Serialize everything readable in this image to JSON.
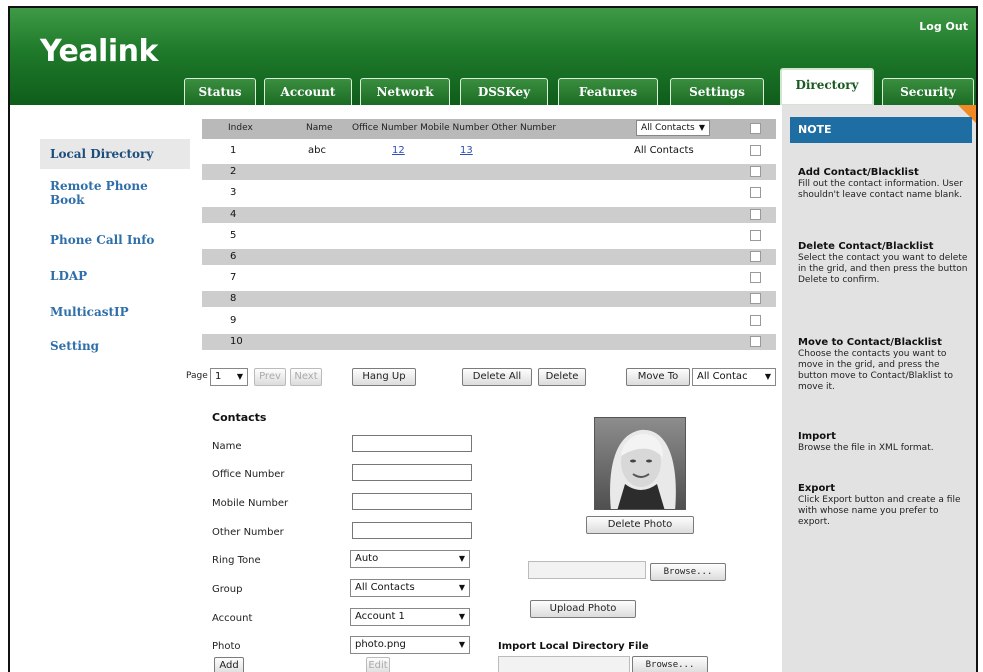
{
  "header": {
    "logo": "Yealink",
    "logout": "Log Out",
    "tabs": [
      "Status",
      "Account",
      "Network",
      "DSSKey",
      "Features",
      "Settings",
      "Directory",
      "Security"
    ],
    "active_tab": "Directory"
  },
  "sidebar": {
    "items": [
      "Local Directory",
      "Remote Phone\nBook",
      "Phone Call Info",
      "LDAP",
      "MulticastIP",
      "Setting"
    ]
  },
  "grid": {
    "headers": {
      "index": "Index",
      "name": "Name",
      "numbers": "Office Number Mobile Number Other Number",
      "group_filter": "All Contacts"
    },
    "rows": [
      {
        "index": "1",
        "name": "abc",
        "office": "12",
        "mobile": "13",
        "other": "All Contacts"
      },
      {
        "index": "2",
        "name": "",
        "office": "",
        "mobile": "",
        "other": ""
      },
      {
        "index": "3",
        "name": "",
        "office": "",
        "mobile": "",
        "other": ""
      },
      {
        "index": "4",
        "name": "",
        "office": "",
        "mobile": "",
        "other": ""
      },
      {
        "index": "5",
        "name": "",
        "office": "",
        "mobile": "",
        "other": ""
      },
      {
        "index": "6",
        "name": "",
        "office": "",
        "mobile": "",
        "other": ""
      },
      {
        "index": "7",
        "name": "",
        "office": "",
        "mobile": "",
        "other": ""
      },
      {
        "index": "8",
        "name": "",
        "office": "",
        "mobile": "",
        "other": ""
      },
      {
        "index": "9",
        "name": "",
        "office": "",
        "mobile": "",
        "other": ""
      },
      {
        "index": "10",
        "name": "",
        "office": "",
        "mobile": "",
        "other": ""
      }
    ],
    "pager": {
      "page_label": "Page",
      "page_value": "1",
      "prev": "Prev",
      "next": "Next"
    },
    "buttons": {
      "hang_up": "Hang Up",
      "delete_all": "Delete All",
      "delete": "Delete",
      "move_to": "Move To",
      "move_target": "All Contac"
    }
  },
  "contacts": {
    "title": "Contacts",
    "fields": {
      "name": "Name",
      "office": "Office Number",
      "mobile": "Mobile Number",
      "other": "Other Number",
      "ring_tone": "Ring Tone",
      "group": "Group",
      "account": "Account",
      "photo": "Photo"
    },
    "values": {
      "ring_tone": "Auto",
      "group": "All Contacts",
      "account": "Account 1",
      "photo": "photo.png"
    },
    "buttons": {
      "delete_photo": "Delete Photo",
      "browse": "Browse...",
      "upload_photo": "Upload Photo",
      "add": "Add",
      "edit": "Edit"
    },
    "import_title": "Import Local Directory File"
  },
  "note": {
    "title": "NOTE",
    "sections": [
      {
        "title": "Add Contact/Blacklist",
        "desc": "Fill out the contact information. User shouldn't leave contact name blank."
      },
      {
        "title": "Delete Contact/Blacklist",
        "desc": "Select the contact you want to delete in the grid, and then press the button Delete to confirm."
      },
      {
        "title": "Move to Contact/Blacklist",
        "desc": "Choose the contacts you want to move in the grid, and press the button move to Contact/Blaklist to move it."
      },
      {
        "title": "Import",
        "desc": "Browse the file in XML format."
      },
      {
        "title": "Export",
        "desc": "Click Export button and create a file with whose name you prefer to export."
      }
    ]
  },
  "colors": {
    "header_green": "#1e7a2a",
    "nav_blue": "#2f6fa9",
    "note_blue": "#1f6ea3",
    "note_orange": "#f18a24"
  }
}
